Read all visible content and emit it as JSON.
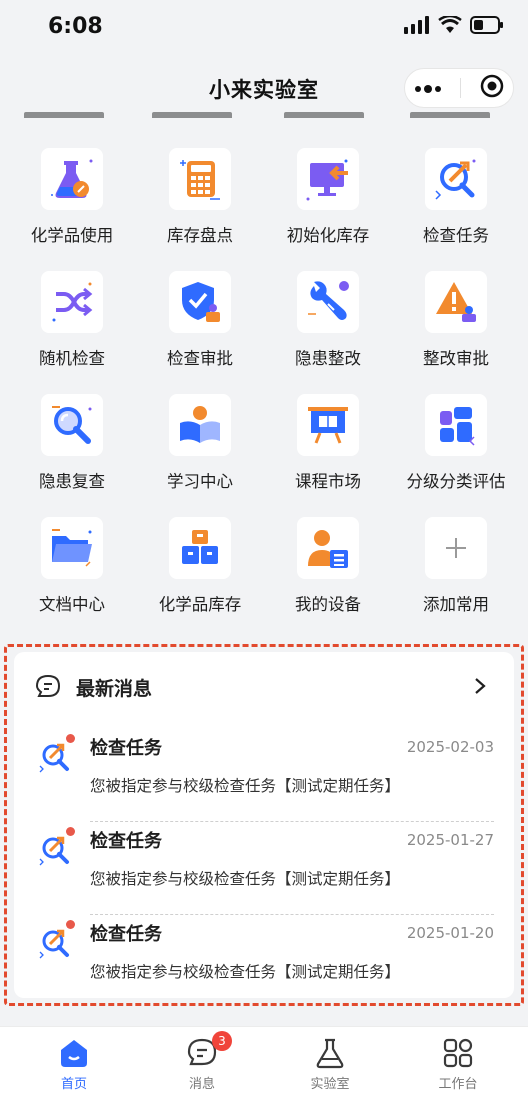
{
  "status_bar": {
    "time": "6:08"
  },
  "nav": {
    "title": "小来实验室"
  },
  "grid": [
    {
      "label": "化学品使用",
      "icon": "flask-icon"
    },
    {
      "label": "库存盘点",
      "icon": "calculator-icon"
    },
    {
      "label": "初始化库存",
      "icon": "monitor-import-icon"
    },
    {
      "label": "检查任务",
      "icon": "inspect-search-icon"
    },
    {
      "label": "随机检查",
      "icon": "shuffle-icon"
    },
    {
      "label": "检查审批",
      "icon": "shield-check-icon"
    },
    {
      "label": "隐患整改",
      "icon": "wrench-icon"
    },
    {
      "label": "整改审批",
      "icon": "warning-stamp-icon"
    },
    {
      "label": "隐患复查",
      "icon": "magnifier-icon"
    },
    {
      "label": "学习中心",
      "icon": "reader-book-icon"
    },
    {
      "label": "课程市场",
      "icon": "presentation-icon"
    },
    {
      "label": "分级分类评估",
      "icon": "blocks-icon"
    },
    {
      "label": "文档中心",
      "icon": "folder-icon"
    },
    {
      "label": "化学品库存",
      "icon": "boxes-icon"
    },
    {
      "label": "我的设备",
      "icon": "user-device-icon"
    },
    {
      "label": "添加常用",
      "icon": "plus-icon"
    }
  ],
  "messages": {
    "title": "最新消息",
    "items": [
      {
        "title": "检查任务",
        "date": "2025-02-03",
        "text": "您被指定参与校级检查任务【测试定期任务】"
      },
      {
        "title": "检查任务",
        "date": "2025-01-27",
        "text": "您被指定参与校级检查任务【测试定期任务】"
      },
      {
        "title": "检查任务",
        "date": "2025-01-20",
        "text": "您被指定参与校级检查任务【测试定期任务】"
      }
    ]
  },
  "tabs": [
    {
      "label": "首页",
      "icon": "home-icon",
      "active": true
    },
    {
      "label": "消息",
      "icon": "chat-icon",
      "badge": "3"
    },
    {
      "label": "实验室",
      "icon": "flask-tab-icon"
    },
    {
      "label": "工作台",
      "icon": "grid-icon"
    }
  ],
  "colors": {
    "accent": "#2f6bff",
    "orange": "#f28a2e",
    "purple": "#7b5cf2",
    "highlight": "#e24a2e"
  }
}
